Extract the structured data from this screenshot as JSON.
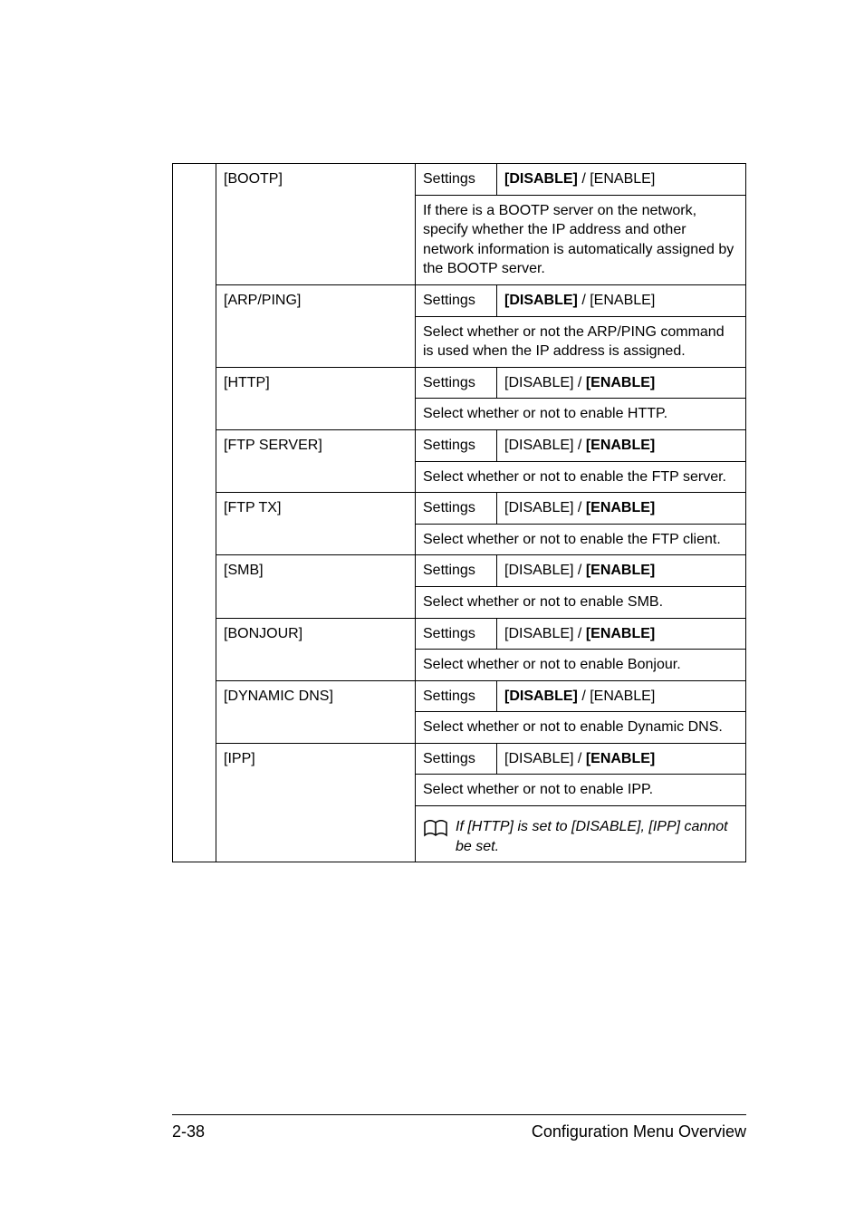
{
  "rows": {
    "bootp": {
      "label": "[BOOTP]",
      "settings_label": "Settings",
      "settings_value_html": "<b>[DISABLE]</b> / [ENABLE]",
      "desc": "If there is a BOOTP server on the network, specify whether the IP address and other network information is automatically assigned by the BOOTP server."
    },
    "arpping": {
      "label": "[ARP/PING]",
      "settings_label": "Settings",
      "settings_value_html": "<b>[DISABLE]</b> / [ENABLE]",
      "desc": "Select whether or not the ARP/PING command is used when the IP address is assigned."
    },
    "http": {
      "label": "[HTTP]",
      "settings_label": "Settings",
      "settings_value_html": "[DISABLE] / <b>[ENABLE]</b>",
      "desc": "Select whether or not to enable HTTP."
    },
    "ftpserver": {
      "label": "[FTP SERVER]",
      "settings_label": "Settings",
      "settings_value_html": "[DISABLE] / <b>[ENABLE]</b>",
      "desc": "Select whether or not to enable the FTP server."
    },
    "ftptx": {
      "label": "[FTP TX]",
      "settings_label": "Settings",
      "settings_value_html": "[DISABLE] / <b>[ENABLE]</b>",
      "desc": "Select whether or not to enable the FTP client."
    },
    "smb": {
      "label": "[SMB]",
      "settings_label": "Settings",
      "settings_value_html": "[DISABLE] / <b>[ENABLE]</b>",
      "desc": "Select whether or not to enable SMB."
    },
    "bonjour": {
      "label": "[BONJOUR]",
      "settings_label": "Settings",
      "settings_value_html": "[DISABLE] / <b>[ENABLE]</b>",
      "desc": "Select whether or not to enable Bonjour."
    },
    "dynamicdns": {
      "label": "[DYNAMIC DNS]",
      "settings_label": "Settings",
      "settings_value_html": "<b>[DISABLE]</b> / [ENABLE]",
      "desc": "Select whether or not to enable Dynamic DNS."
    },
    "ipp": {
      "label": "[IPP]",
      "settings_label": "Settings",
      "settings_value_html": "[DISABLE] / <b>[ENABLE]</b>",
      "desc": "Select whether or not to enable IPP.",
      "note": "If [HTTP] is set to [DISABLE], [IPP] cannot be set."
    }
  },
  "footer": {
    "page": "2-38",
    "title": "Configuration Menu Overview"
  }
}
